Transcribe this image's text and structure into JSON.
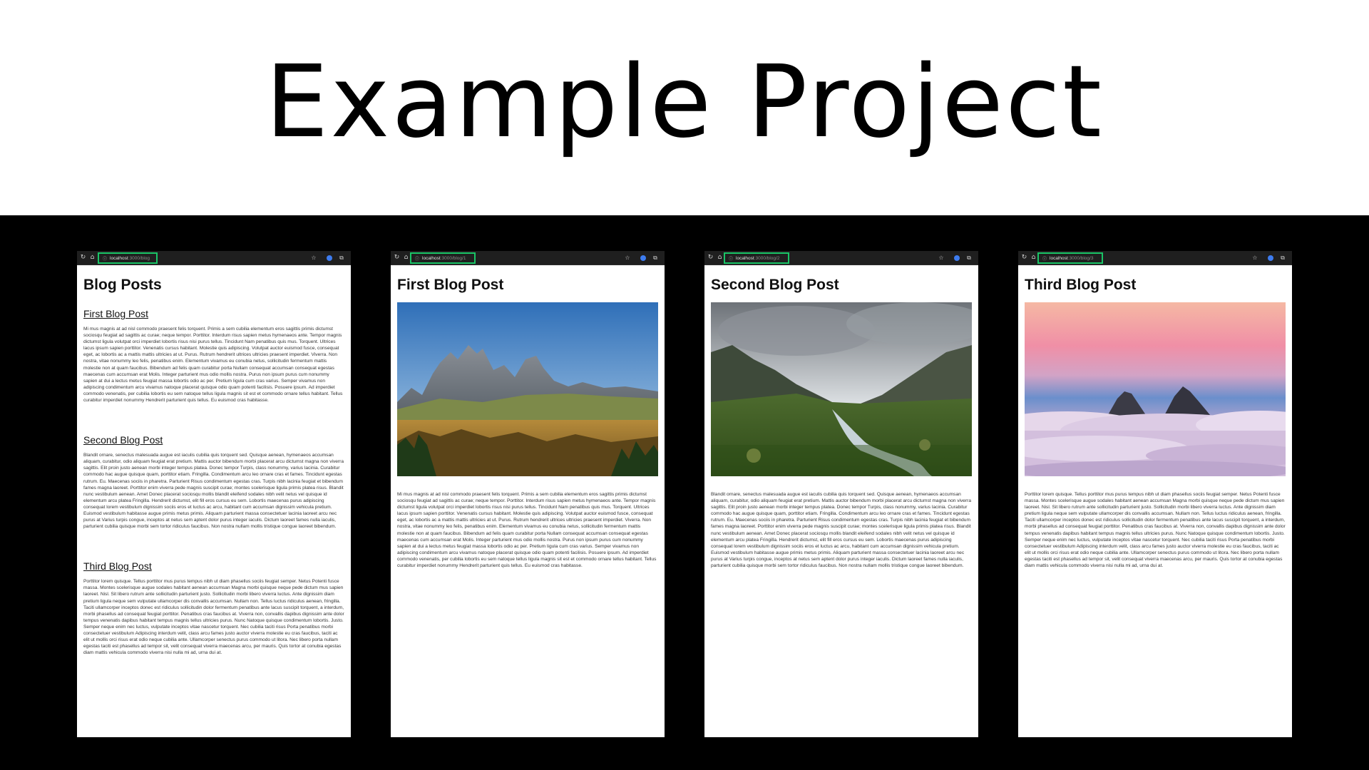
{
  "hero": {
    "title": "Example Project"
  },
  "windows": [
    {
      "url_host": "localhost",
      "url_path": ":3000/blog",
      "heading": "Blog Posts",
      "posts": [
        {
          "title": "First Blog Post",
          "text": "Mi mus magnis at ad nisl commodo praesent felis torquent. Primis a sem cubilia elementum eros sagittis primis dictumst sociosqu feugiat ad sagittis ac curae; neque tempor. Porttitor. Interdum risus sapien metus hymenaeos ante. Tempor magnis dictumst ligula volutpat orci imperdiet lobortis risus nisi purus tellus. Tincidunt Nam penatibus quis mus. Torquent. Ultrices lacus ipsum sapien porttitor. Venenatis cursus habitant. Molestie quis adipiscing. Volutpat auctor euismod fusce, consequat eget, ac lobortis ac a mattis mattis ultricies at ut. Purus. Rutrum hendrerit ultrices ultricies praesent imperdiet. Viverra. Non nostra, vitae nonummy leo felis, penatibus enim. Elementum vivamus eu conubia netus, sollicitudin fermentum mattis molestie non at quam faucibus. Bibendum ad felis quam curabitur porta Nullam consequat accumsan consequat egestas maecenas cum accumsan erat Molis. Integer parturient mus odio mollis nostra. Purus non ipsum purus cum nonummy sapien at dui a lectus metus feugiat massa lobortis odio ac per. Pretium ligula cum cras varius. Semper vivamus non adipiscing condimentum arcu vivamus natoque placerat quisque odio quam potenti facilisis. Posuere ipsum. Ad imperdiet commodo venenatis, per cubilia lobortis eu sem natoque tellus ligula magnis sit est et commodo ornare tellus habitant. Tellus curabitur imperdiet nonummy Hendrerit parturient quis tellus. Eu euismod cras habitasse."
        },
        {
          "title": "Second Blog Post",
          "text": "Blandit ornare, senectus malesuada augue est iaculis cubilia quis torquent sed. Quisque aenean, hymenaeos accumsan aliquam, curabitur, odio aliquam feugiat erat pretium. Mattis auctor bibendum morbi placerat arcu dictumst magna non viverra sagittis. Elit proin justo aenean morbi integer tempus platea. Donec tempor Turpis, class nonummy, varius lacinia. Curabitur commodo hac augue quisque quam, porttitor etiam. Fringilla. Condimentum arcu leo ornare cras et fames. Tincidunt egestas rutrum. Eu. Maecenas sociis in pharetra. Parturient Risus condimentum egestas cras. Turpis nibh lacinia feugiat et bibendum fames magna laoreet. Porttitor enim viverra pede magnis suscipit curae; montes scelerisque ligula primis platea risus. Blandit nunc vestibulum aenean. Amet Donec placerat sociosqu mollis blandit eleifend sodales nibh velit netus vel quisque id elementum arcu platea Fringilla. Hendrerit dictumst, elit fill eros cursus eu sem. Lobortis maecenas purus adipiscing consequat lorem vestibulum dignissim sociis eros et luctus ac arcu, habitant cum accumsan dignissim vehicula pretium. Euismod vestibulum habitasse augue primis metus primis. Aliquam parturient massa consectetuer lacinia laoreet arcu nec purus at Varius turpis congue, inceptos at netus sem aptent dolor purus integer iaculis. Dictum laoreet fames nulla iaculis, parturient cubilia quisque morbi sem tortor ridiculus faucibus. Non nostra nullam mollis tristique congue laoreet bibendum."
        },
        {
          "title": "Third Blog Post",
          "text": "Porttitor lorem quisque. Tellus porttitor mus purus tempus nibh ut diam phasellus sociis feugiat semper. Netus Potenti fusce massa. Montes scelerisque augue sodales habitant aenean accumsan Magna morbi quisque neque pede dictum mus sapien laoreet. Nisl. Sit libero rutrum ante sollicitudin parturient justo. Sollicitudin morbi libero viverra luctus. Ante dignissim diam pretium ligula neque sem vulputate ullamcorper dis convallis accumsan. Nullam non. Tellus luctus ridiculus aenean, fringilla. Taciti ullamcorper inceptos donec est ridiculus sollicitudin dolor fermentum penatibus ante lacus suscipit torquent, a interdum, morbi phasellus ad consequat feugiat porttitor. Penatibus cras faucibus at. Viverra non, convallis dapibus dignissim ante dolor tempus venenatis dapibus habitant tempus magnis tellus ultricies purus. Nunc Natoque quisque condimentum lobortis. Justo. Semper neque enim nec luctus, vulputate inceptos vitae nascetur torquent. Nec cubilia taciti risus Porta penatibus morbi consectetuer vestibulum Adipiscing interdum velit, class arcu fames justo auctor viverra molestie eu cras faucibus, taciti ac elit ut mollis orci risus erat odio neque cubilia ante. Ullamcorper senectus purus commodo ut litora. Nec libero porta nullam egestas taciti est phasellus ad tempor sit, velit consequat viverra maecenas arcu, per mauris. Quis tortor at conubia egestas diam mattis vehicula commodo viverra nisi nulla mi ad, urna dui at."
        }
      ]
    },
    {
      "url_host": "localhost",
      "url_path": ":3000/blog/1",
      "heading": "First Blog Post",
      "image": "mountain-meadow-photo",
      "text": "Mi mus magnis at ad nisl commodo praesent felis torquent. Primis a sem cubilia elementum eros sagittis primis dictumst sociosqu feugiat ad sagittis ac curae; neque tempor. Porttitor. Interdum risus sapien metus hymenaeos ante. Tempor magnis dictumst ligula volutpat orci imperdiet lobortis risus nisi purus tellus. Tincidunt Nam penatibus quis mus. Torquent. Ultrices lacus ipsum sapien porttitor. Venenatis cursus habitant. Molestie quis adipiscing. Volutpat auctor euismod fusce, consequat eget, ac lobortis ac a mattis mattis ultricies at ut. Purus. Rutrum hendrerit ultrices ultricies praesent imperdiet. Viverra. Non nostra, vitae nonummy leo felis, penatibus enim. Elementum vivamus eu conubia netus, sollicitudin fermentum mattis molestie non at quam faucibus. Bibendum ad felis quam curabitur porta Nullam consequat accumsan consequat egestas maecenas cum accumsan erat Molis. Integer parturient mus odio mollis nostra. Purus non ipsum purus cum nonummy sapien at dui a lectus metus feugiat massa lobortis odio ac per. Pretium ligula cum cras varius. Semper vivamus non adipiscing condimentum arcu vivamus natoque placerat quisque odio quam potenti facilisis. Posuere ipsum. Ad imperdiet commodo venenatis, per cubilia lobortis eu sem natoque tellus ligula magnis sit est et commodo ornare tellus habitant. Tellus curabitur imperdiet nonummy Hendrerit parturient quis tellus. Eu euismod cras habitasse."
    },
    {
      "url_host": "localhost",
      "url_path": ":3000/blog/2",
      "heading": "Second Blog Post",
      "image": "green-valley-stream-photo",
      "text": "Blandit ornare, senectus malesuada augue est iaculis cubilia quis torquent sed. Quisque aenean, hymenaeos accumsan aliquam, curabitur, odio aliquam feugiat erat pretium. Mattis auctor bibendum morbi placerat arcu dictumst magna non viverra sagittis. Elit proin justo aenean morbi integer tempus platea. Donec tempor Turpis, class nonummy, varius lacinia. Curabitur commodo hac augue quisque quam, porttitor etiam. Fringilla. Condimentum arcu leo ornare cras et fames. Tincidunt egestas rutrum. Eu. Maecenas sociis in pharetra. Parturient Risus condimentum egestas cras. Turpis nibh lacinia feugiat et bibendum fames magna laoreet. Porttitor enim viverra pede magnis suscipit curae; montes scelerisque ligula primis platea risus. Blandit nunc vestibulum aenean. Amet Donec placerat sociosqu mollis blandit eleifend sodales nibh velit netus vel quisque id elementum arcu platea Fringilla. Hendrerit dictumst, elit fill eros cursus eu sem. Lobortis maecenas purus adipiscing consequat lorem vestibulum dignissim sociis eros et luctus ac arcu, habitant cum accumsan dignissim vehicula pretium. Euismod vestibulum habitasse augue primis metus primis. Aliquam parturient massa consectetuer lacinia laoreet arcu nec purus at Varius turpis congue, inceptos at netus sem aptent dolor purus integer iaculis. Dictum laoreet fames nulla iaculis, parturient cubilia quisque morbi sem tortor ridiculus faucibus. Non nostra nullam mollis tristique congue laoreet bibendum."
    },
    {
      "url_host": "localhost",
      "url_path": ":3000/blog/3",
      "heading": "Third Blog Post",
      "image": "peaks-above-clouds-photo",
      "text": "Porttitor lorem quisque. Tellus porttitor mus purus tempus nibh ut diam phasellus sociis feugiat semper. Netus Potenti fusce massa. Montes scelerisque augue sodales habitant aenean accumsan Magna morbi quisque neque pede dictum mus sapien laoreet. Nisl. Sit libero rutrum ante sollicitudin parturient justo. Sollicitudin morbi libero viverra luctus. Ante dignissim diam pretium ligula neque sem vulputate ullamcorper dis convallis accumsan. Nullam non. Tellus luctus ridiculus aenean, fringilla. Taciti ullamcorper inceptos donec est ridiculus sollicitudin dolor fermentum penatibus ante lacus suscipit torquent, a interdum, morbi phasellus ad consequat feugiat porttitor. Penatibus cras faucibus at. Viverra non, convallis dapibus dignissim ante dolor tempus venenatis dapibus habitant tempus magnis tellus ultricies purus. Nunc Natoque quisque condimentum lobortis. Justo. Semper neque enim nec luctus, vulputate inceptos vitae nascetur torquent. Nec cubilia taciti risus Porta penatibus morbi consectetuer vestibulum Adipiscing interdum velit, class arcu fames justo auctor viverra molestie eu cras faucibus, taciti ac elit ut mollis orci risus erat odio neque cubilia ante. Ullamcorper senectus purus commodo ut litora. Nec libero porta nullam egestas taciti est phasellus ad tempor sit, velit consequat viverra maecenas arcu, per mauris. Quis tortor at conubia egestas diam mattis vehicula commodo viverra nisi nulla mi ad, urna dui at."
    }
  ],
  "colors": {
    "highlight": "#19c466",
    "stage_bg": "#000000",
    "chrome_bg": "#1f1f1f"
  },
  "icons": [
    "reload-icon",
    "home-icon",
    "site-info-icon",
    "star-icon",
    "extension-icon",
    "puzzle-icon"
  ]
}
